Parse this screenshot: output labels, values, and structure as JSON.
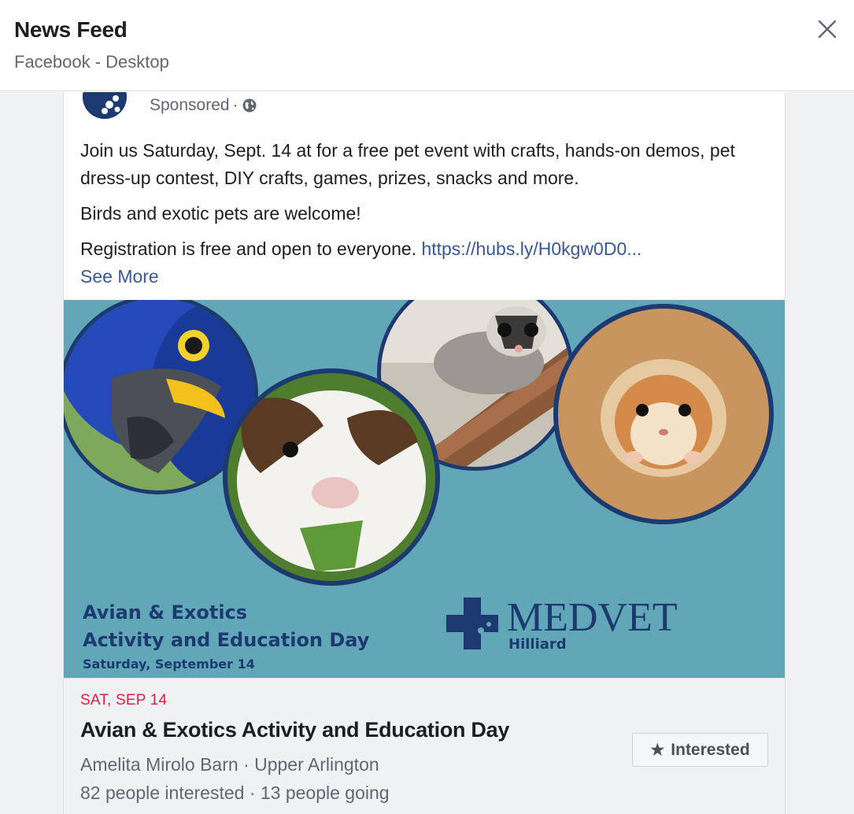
{
  "header": {
    "title": "News Feed",
    "subtitle": "Facebook - Desktop"
  },
  "post": {
    "sponsored_label": "Sponsored",
    "separator": "·",
    "paragraphs": [
      "Join us Saturday, Sept. 14 at for a free pet event with crafts, hands-on demos, pet dress-up contest, DIY crafts, games, prizes, snacks and more.",
      "Birds and exotic pets are welcome!"
    ],
    "registration_text": "Registration is free and open to everyone. ",
    "link_text": "https://hubs.ly/H0kgw0D0...",
    "see_more": "See More"
  },
  "ad_image": {
    "line1": "Avian & Exotics",
    "line2": "Activity and Education Day",
    "line3": "Saturday, September 14",
    "brand": "MEDVET",
    "brand_location": "Hilliard",
    "background_color": "#62a7b8",
    "accent_color": "#1d3a70"
  },
  "event": {
    "date": "SAT, SEP 14",
    "title": "Avian & Exotics Activity and Education Day",
    "location": "Amelita Mirolo Barn · Upper Arlington",
    "stats": "82 people interested · 13 people going",
    "interested_label": "Interested"
  },
  "icons": {
    "close": "close-icon",
    "globe": "globe-icon",
    "star": "star-icon"
  }
}
